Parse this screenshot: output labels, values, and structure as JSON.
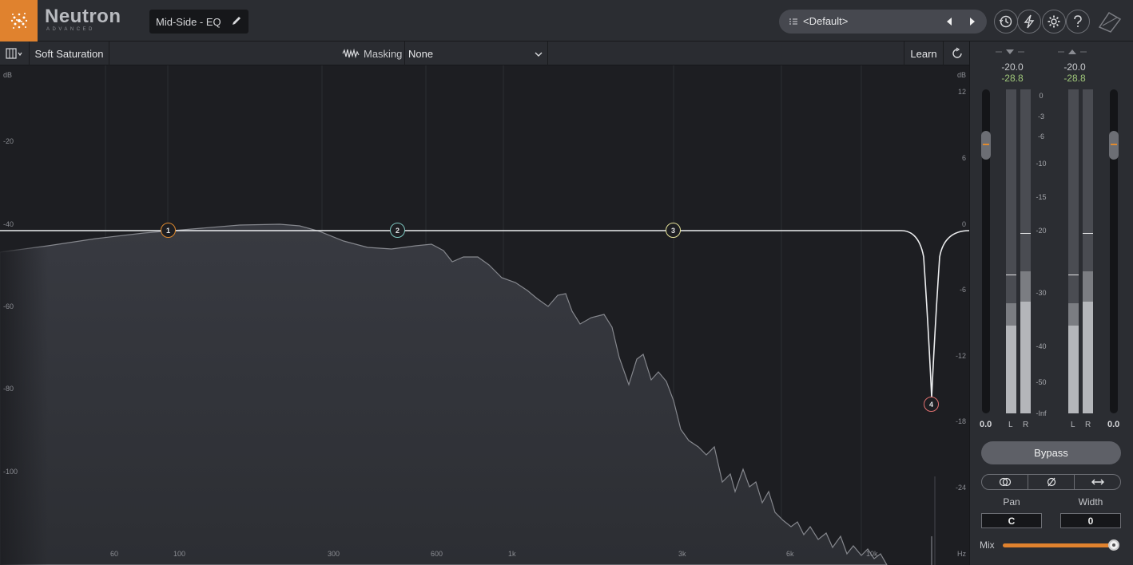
{
  "header": {
    "brand_name": "Neutron",
    "brand_sub": "ADVANCED",
    "module_name": "Mid-Side - EQ",
    "preset_name": "<Default>",
    "icons": [
      "history-icon",
      "lightning-icon",
      "gear-icon",
      "help-icon"
    ]
  },
  "toolbar": {
    "soft_saturation_label": "Soft Saturation",
    "masking_label": "Masking",
    "masking_value": "None",
    "learn_label": "Learn"
  },
  "eq": {
    "left_unit": "dB",
    "right_unit": "dB",
    "freq_unit": "Hz",
    "left_scale": [
      "-20",
      "-40",
      "-60",
      "-80",
      "-100"
    ],
    "right_scale": [
      "12",
      "6",
      "0",
      "-6",
      "-12",
      "-18",
      "-24"
    ],
    "freq_labels": [
      "60",
      "100",
      "300",
      "600",
      "1k",
      "3k",
      "6k",
      "10k"
    ],
    "nodes": [
      {
        "label": "1",
        "color": "#e08a2e"
      },
      {
        "label": "2",
        "color": "#7ec7c0"
      },
      {
        "label": "3",
        "color": "#e6e39a"
      },
      {
        "label": "4",
        "color": "#e07070"
      }
    ]
  },
  "panel": {
    "input": {
      "peak": "-20.0",
      "rms": "-28.8",
      "gain": "0.0"
    },
    "output": {
      "peak": "-20.0",
      "rms": "-28.8",
      "gain": "0.0"
    },
    "meter_scale": [
      "0",
      "-3",
      "-6",
      "-10",
      "-15",
      "-20",
      "-30",
      "-40",
      "-50",
      "-Inf"
    ],
    "channel_left": "L",
    "channel_right": "R",
    "bypass_label": "Bypass",
    "pan_label": "Pan",
    "pan_value": "C",
    "width_label": "Width",
    "width_value": "0",
    "mix_label": "Mix",
    "mix_percent": 100,
    "accent_color": "#e0822e"
  }
}
